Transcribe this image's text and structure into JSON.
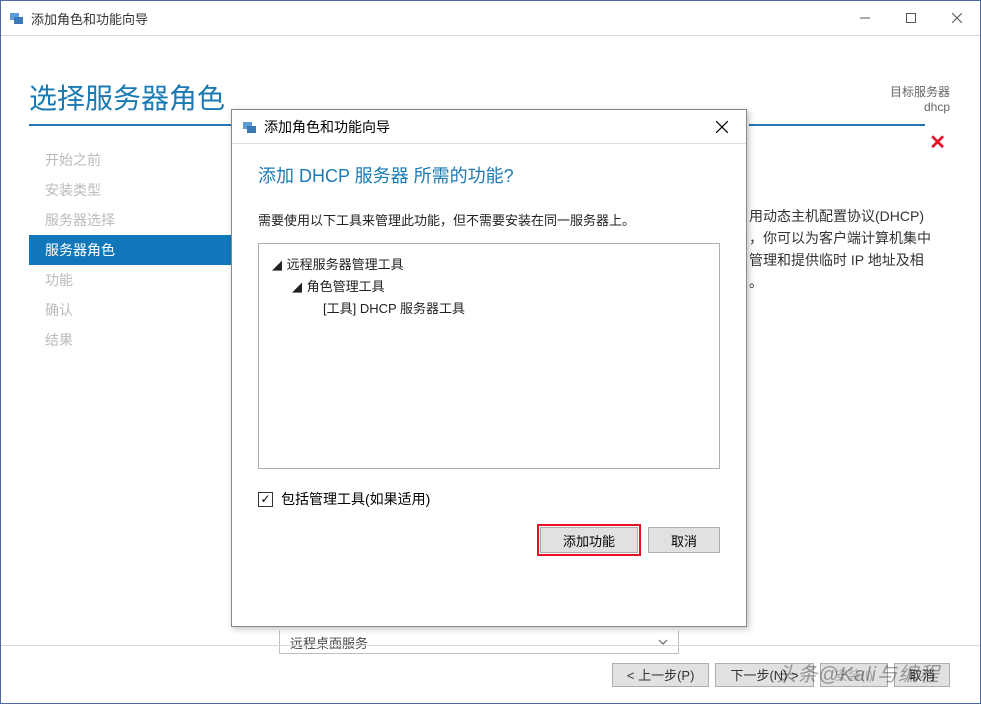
{
  "window": {
    "title": "添加角色和功能向导",
    "minimize_label": "—",
    "maximize_label": "☐",
    "close_label": "✕"
  },
  "main": {
    "heading": "选择服务器角色",
    "target_server_label": "目标服务器",
    "target_server_value": "dhcp",
    "truncated_item": "远程桌面服务"
  },
  "sidebar": {
    "items": [
      {
        "label": "开始之前",
        "active": false
      },
      {
        "label": "安装类型",
        "active": false
      },
      {
        "label": "服务器选择",
        "active": false
      },
      {
        "label": "服务器角色",
        "active": true
      },
      {
        "label": "功能",
        "active": false
      },
      {
        "label": "确认",
        "active": false
      },
      {
        "label": "结果",
        "active": false
      }
    ]
  },
  "description": {
    "line1": "用动态主机配置协议(DHCP)",
    "line2": "，你可以为客户端计算机集中",
    "line3": "管理和提供临时 IP 地址及相",
    "line4": "。"
  },
  "dialog": {
    "title": "添加角色和功能向导",
    "heading": "添加 DHCP 服务器 所需的功能?",
    "description": "需要使用以下工具来管理此功能，但不需要安装在同一服务器上。",
    "tree": {
      "node1": "远程服务器管理工具",
      "node2": "角色管理工具",
      "node3": "[工具] DHCP 服务器工具"
    },
    "checkbox_label": "包括管理工具(如果适用)",
    "checkbox_checked": "✓",
    "add_button": "添加功能",
    "cancel_button": "取消",
    "close_x": "✕"
  },
  "buttons": {
    "prev": "< 上一步(P)",
    "next": "下一步(N) >",
    "install": "安装(I)",
    "cancel": "取消"
  },
  "watermark": "头条@Kali与编程"
}
